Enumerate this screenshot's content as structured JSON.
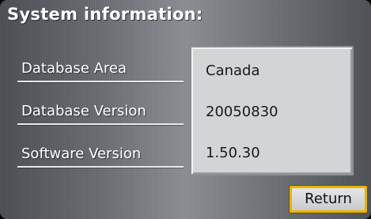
{
  "header": {
    "title": "System information:"
  },
  "info_rows": [
    {
      "label": "Database Area",
      "value": "Canada"
    },
    {
      "label": "Database Version",
      "value": "20050830"
    },
    {
      "label": "Software Version",
      "value": "1.50.30"
    }
  ],
  "footer": {
    "return_label": "Return"
  },
  "colors": {
    "background": "#6a6d72",
    "panel": "#d3d4d6",
    "focus_border": "#e8b400"
  }
}
